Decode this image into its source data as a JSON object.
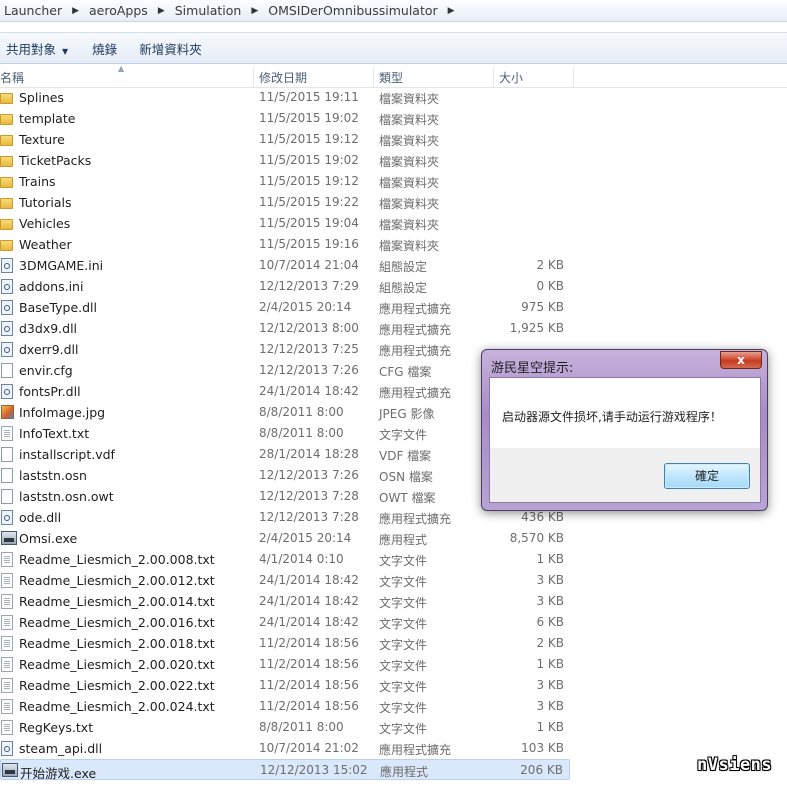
{
  "breadcrumb": [
    "Launcher",
    "aeroApps",
    "Simulation",
    "OMSIDerOmnibussimulator"
  ],
  "toolbar": {
    "share_label": "共用對象",
    "burn_label": "燒錄",
    "newfolder_label": "新增資料夾"
  },
  "columns": {
    "name": "名稱",
    "date": "修改日期",
    "type": "類型",
    "size": "大小"
  },
  "files": [
    {
      "name": "Splines",
      "date": "11/5/2015 19:11",
      "type": "檔案資料夾",
      "size": "",
      "icon": "folder-icon"
    },
    {
      "name": "template",
      "date": "11/5/2015 19:02",
      "type": "檔案資料夾",
      "size": "",
      "icon": "folder-icon"
    },
    {
      "name": "Texture",
      "date": "11/5/2015 19:12",
      "type": "檔案資料夾",
      "size": "",
      "icon": "folder-icon"
    },
    {
      "name": "TicketPacks",
      "date": "11/5/2015 19:02",
      "type": "檔案資料夾",
      "size": "",
      "icon": "folder-icon"
    },
    {
      "name": "Trains",
      "date": "11/5/2015 19:12",
      "type": "檔案資料夾",
      "size": "",
      "icon": "folder-icon"
    },
    {
      "name": "Tutorials",
      "date": "11/5/2015 19:22",
      "type": "檔案資料夾",
      "size": "",
      "icon": "folder-icon"
    },
    {
      "name": "Vehicles",
      "date": "11/5/2015 19:04",
      "type": "檔案資料夾",
      "size": "",
      "icon": "folder-icon"
    },
    {
      "name": "Weather",
      "date": "11/5/2015 19:16",
      "type": "檔案資料夾",
      "size": "",
      "icon": "folder-icon"
    },
    {
      "name": "3DMGAME.ini",
      "date": "10/7/2014 21:04",
      "type": "組態設定",
      "size": "2 KB",
      "icon": "config-file-icon"
    },
    {
      "name": "addons.ini",
      "date": "12/12/2013 7:29",
      "type": "組態設定",
      "size": "0 KB",
      "icon": "config-file-icon"
    },
    {
      "name": "BaseType.dll",
      "date": "2/4/2015 20:14",
      "type": "應用程式擴充",
      "size": "975 KB",
      "icon": "dll-file-icon"
    },
    {
      "name": "d3dx9.dll",
      "date": "12/12/2013 8:00",
      "type": "應用程式擴充",
      "size": "1,925 KB",
      "icon": "dll-file-icon"
    },
    {
      "name": "dxerr9.dll",
      "date": "12/12/2013 7:25",
      "type": "應用程式擴充",
      "size": "",
      "icon": "dll-file-icon"
    },
    {
      "name": "envir.cfg",
      "date": "12/12/2013 7:26",
      "type": "CFG 檔案",
      "size": "",
      "icon": "file-icon"
    },
    {
      "name": "fontsPr.dll",
      "date": "24/1/2014 18:42",
      "type": "應用程式擴充",
      "size": "",
      "icon": "dll-file-icon"
    },
    {
      "name": "InfoImage.jpg",
      "date": "8/8/2011 8:00",
      "type": "JPEG 影像",
      "size": "",
      "icon": "image-file-icon"
    },
    {
      "name": "InfoText.txt",
      "date": "8/8/2011 8:00",
      "type": "文字文件",
      "size": "",
      "icon": "text-file-icon"
    },
    {
      "name": "installscript.vdf",
      "date": "28/1/2014 18:28",
      "type": "VDF 檔案",
      "size": "",
      "icon": "file-icon"
    },
    {
      "name": "laststn.osn",
      "date": "12/12/2013 7:26",
      "type": "OSN 檔案",
      "size": "",
      "icon": "file-icon"
    },
    {
      "name": "laststn.osn.owt",
      "date": "12/12/2013 7:28",
      "type": "OWT 檔案",
      "size": "",
      "icon": "file-icon"
    },
    {
      "name": "ode.dll",
      "date": "12/12/2013 7:28",
      "type": "應用程式擴充",
      "size": "436 KB",
      "icon": "dll-file-icon"
    },
    {
      "name": "Omsi.exe",
      "date": "2/4/2015 20:14",
      "type": "應用程式",
      "size": "8,570 KB",
      "icon": "exe-icon"
    },
    {
      "name": "Readme_Liesmich_2.00.008.txt",
      "date": "4/1/2014 0:10",
      "type": "文字文件",
      "size": "1 KB",
      "icon": "text-file-icon"
    },
    {
      "name": "Readme_Liesmich_2.00.012.txt",
      "date": "24/1/2014 18:42",
      "type": "文字文件",
      "size": "3 KB",
      "icon": "text-file-icon"
    },
    {
      "name": "Readme_Liesmich_2.00.014.txt",
      "date": "24/1/2014 18:42",
      "type": "文字文件",
      "size": "3 KB",
      "icon": "text-file-icon"
    },
    {
      "name": "Readme_Liesmich_2.00.016.txt",
      "date": "24/1/2014 18:42",
      "type": "文字文件",
      "size": "6 KB",
      "icon": "text-file-icon"
    },
    {
      "name": "Readme_Liesmich_2.00.018.txt",
      "date": "11/2/2014 18:56",
      "type": "文字文件",
      "size": "2 KB",
      "icon": "text-file-icon"
    },
    {
      "name": "Readme_Liesmich_2.00.020.txt",
      "date": "11/2/2014 18:56",
      "type": "文字文件",
      "size": "1 KB",
      "icon": "text-file-icon"
    },
    {
      "name": "Readme_Liesmich_2.00.022.txt",
      "date": "11/2/2014 18:56",
      "type": "文字文件",
      "size": "3 KB",
      "icon": "text-file-icon"
    },
    {
      "name": "Readme_Liesmich_2.00.024.txt",
      "date": "11/2/2014 18:56",
      "type": "文字文件",
      "size": "3 KB",
      "icon": "text-file-icon"
    },
    {
      "name": "RegKeys.txt",
      "date": "8/8/2011 8:00",
      "type": "文字文件",
      "size": "1 KB",
      "icon": "text-file-icon"
    },
    {
      "name": "steam_api.dll",
      "date": "10/7/2014 21:02",
      "type": "應用程式擴充",
      "size": "103 KB",
      "icon": "dll-file-icon"
    },
    {
      "name": "开始游戏.exe",
      "date": "12/12/2013 15:02",
      "type": "應用程式",
      "size": "206 KB",
      "icon": "exe-icon",
      "selected": true
    }
  ],
  "dialog": {
    "title": "游民星空提示:",
    "message": "启动器源文件损坏,请手动运行游戏程序！",
    "ok_label": "確定",
    "close_label": "x"
  },
  "watermark": "nVsiens"
}
